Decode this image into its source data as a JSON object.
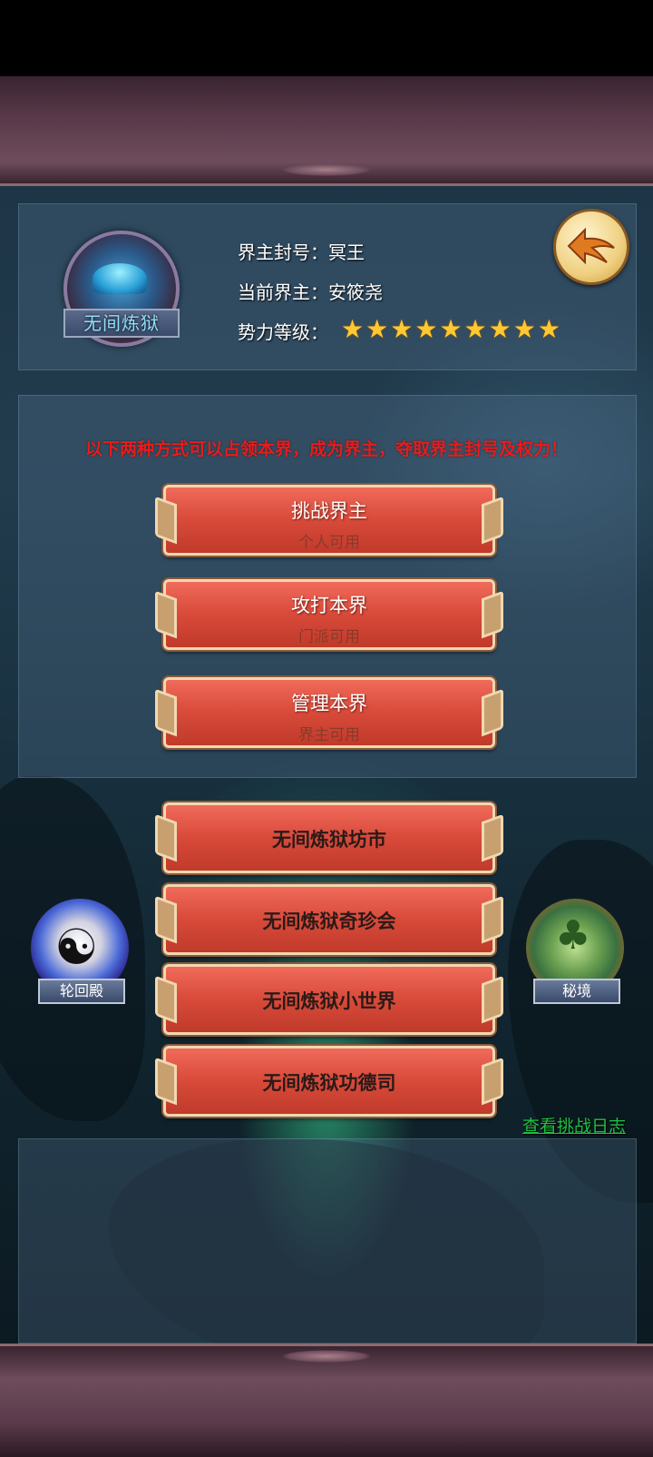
{
  "realm": {
    "emblem_name": "无间炼狱",
    "title_row": "界主封号：冥王",
    "lord_row": "当前界主：安筱尧",
    "level_label": "势力等级：",
    "star_count": 9,
    "star_glyph": "★"
  },
  "notice": "以下两种方式可以占领本界，成为界主，夺取界主封号及权力！",
  "actions": [
    {
      "label": "挑战界主",
      "sub": "个人可用"
    },
    {
      "label": "攻打本界",
      "sub": "门派可用"
    },
    {
      "label": "管理本界",
      "sub": "界主可用"
    }
  ],
  "shops": [
    {
      "label": "无间炼狱坊市"
    },
    {
      "label": "无间炼狱奇珍会"
    },
    {
      "label": "无间炼狱小世界"
    },
    {
      "label": "无间炼狱功德司"
    }
  ],
  "side_icons": {
    "left_label": "轮回殿",
    "right_label": "秘境"
  },
  "log_link": "查看挑战日志",
  "colors": {
    "notice": "#e81c1c",
    "button": "#d84a3a",
    "star": "#ffc830",
    "link": "#20c040"
  }
}
